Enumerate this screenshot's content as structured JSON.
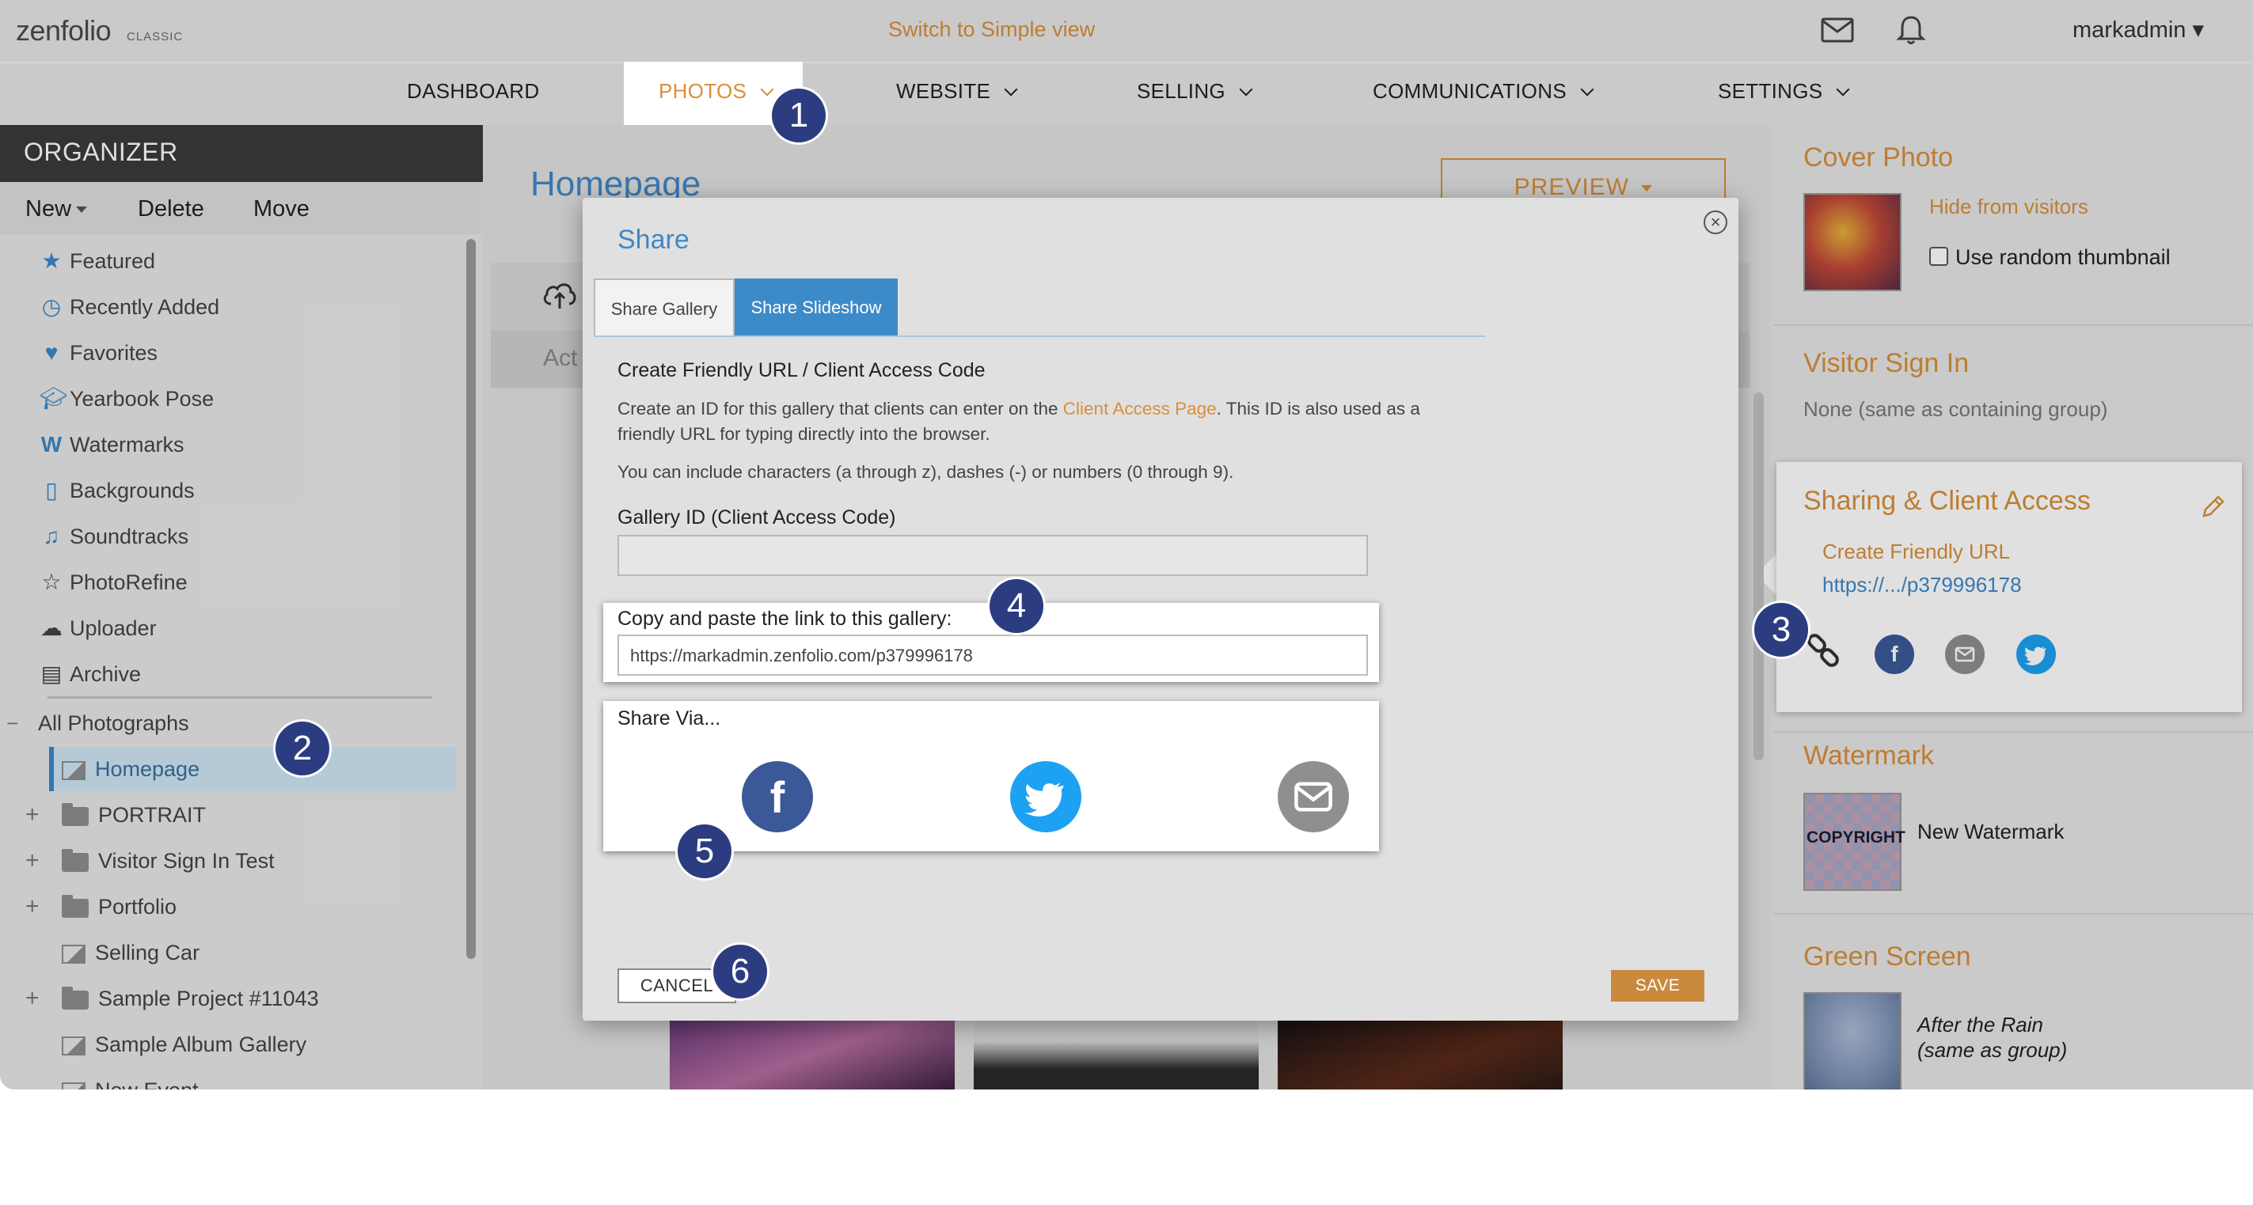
{
  "brand": {
    "logo": "zenfolio",
    "logo_sub": "CLASSIC"
  },
  "header": {
    "switch_view": "Switch to Simple view",
    "username": "markadmin ▾"
  },
  "nav": {
    "dashboard": "DASHBOARD",
    "photos": "PHOTOS",
    "website": "WEBSITE",
    "selling": "SELLING",
    "communications": "COMMUNICATIONS",
    "settings": "SETTINGS"
  },
  "organizer": {
    "title": "ORGANIZER",
    "actions": {
      "new": "New",
      "delete": "Delete",
      "move": "Move"
    },
    "items": [
      {
        "label": "Featured",
        "icon": "star-icon"
      },
      {
        "label": "Recently Added",
        "icon": "clock-icon"
      },
      {
        "label": "Favorites",
        "icon": "heart-icon"
      },
      {
        "label": "Yearbook Pose",
        "icon": "graduation-cap-icon"
      },
      {
        "label": "Watermarks",
        "icon": "watermark-icon"
      },
      {
        "label": "Backgrounds",
        "icon": "background-icon"
      },
      {
        "label": "Soundtracks",
        "icon": "music-note-icon"
      },
      {
        "label": "PhotoRefine",
        "icon": "star-outline-icon"
      },
      {
        "label": "Uploader",
        "icon": "cloud-upload-icon"
      },
      {
        "label": "Archive",
        "icon": "archive-icon"
      }
    ],
    "all_photographs": "All Photographs",
    "tree": [
      {
        "label": "Homepage",
        "type": "gallery",
        "selected": true
      },
      {
        "label": "PORTRAIT",
        "type": "group"
      },
      {
        "label": "Visitor Sign In Test",
        "type": "group"
      },
      {
        "label": "Portfolio",
        "type": "group"
      },
      {
        "label": "Selling Car",
        "type": "gallery"
      },
      {
        "label": "Sample Project #11043",
        "type": "group"
      },
      {
        "label": "Sample Album Gallery",
        "type": "gallery"
      },
      {
        "label": "New Event",
        "type": "event"
      }
    ]
  },
  "main": {
    "title": "Homepage",
    "preview": "PREVIEW",
    "act_text": "Act"
  },
  "modal": {
    "title": "Share",
    "tabs": {
      "gallery": "Share Gallery",
      "slideshow": "Share Slideshow"
    },
    "heading": "Create Friendly URL / Client Access Code",
    "desc_pre": "Create an ID for this gallery that clients can enter on the ",
    "desc_link": "Client Access Page",
    "desc_post": ". This ID is also used as a",
    "desc_line2": "friendly URL for typing directly into the browser.",
    "chars_note": "You can include characters (a through z), dashes (-) or numbers (0 through 9).",
    "gallery_id_label": "Gallery ID (Client Access Code)",
    "gallery_id_value": "",
    "copy_label": "Copy and paste the link to this gallery:",
    "link_value": "https://markadmin.zenfolio.com/p379996178",
    "share_via": "Share Via...",
    "cancel": "CANCEL",
    "save": "SAVE"
  },
  "right": {
    "cover_title": "Cover Photo",
    "hide_visitors": "Hide from visitors",
    "random_thumb": "Use random thumbnail",
    "visitor_title": "Visitor Sign In",
    "visitor_value": "None (same as containing group)",
    "sharing_title": "Sharing & Client Access",
    "friendly_url": "Create Friendly URL",
    "short_link": "https://.../p379996178",
    "watermark_title": "Watermark",
    "watermark_name": "New Watermark",
    "watermark_thumb_text": "COPYRIGHT",
    "greenscreen_title": "Green Screen",
    "greenscreen_line1": "After the Rain",
    "greenscreen_line2": "(same as group)"
  },
  "badges": [
    "1",
    "2",
    "3",
    "4",
    "5",
    "6"
  ],
  "colors": {
    "accent_orange": "#d88f3a",
    "link_blue": "#3f88c6",
    "facebook": "#3b5998",
    "twitter": "#1da1f2",
    "email_gray": "#8f8f8f",
    "badge": "#2c3c80"
  }
}
